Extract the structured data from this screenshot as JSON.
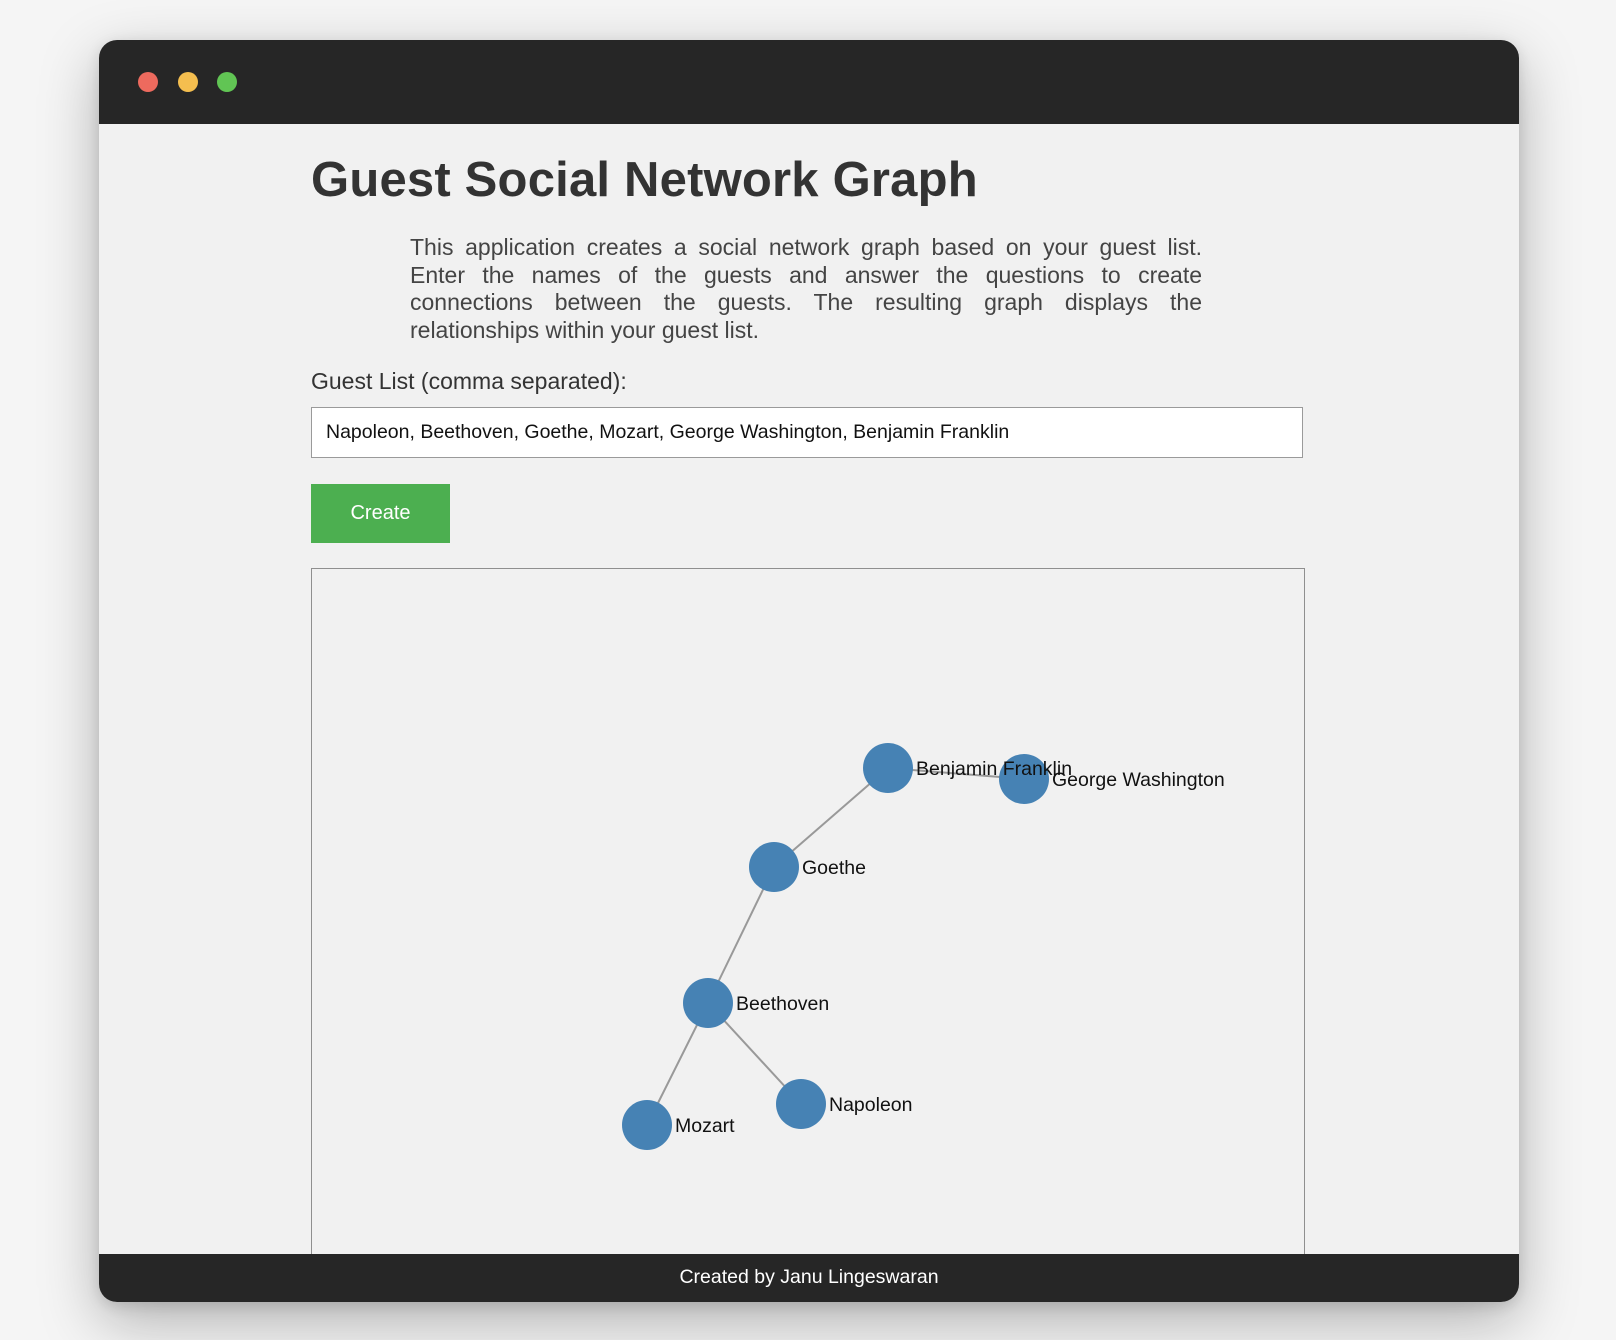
{
  "window": {
    "controls": [
      "close",
      "minimize",
      "maximize"
    ]
  },
  "page": {
    "title": "Guest Social Network Graph",
    "description": "This application creates a social network graph based on your guest list. Enter the names of the guests and answer the questions to create connections between the guests. The resulting graph displays the relationships within your guest list."
  },
  "form": {
    "guest_label": "Guest List (comma separated):",
    "guest_value": "Napoleon, Beethoven, Goethe, Mozart, George Washington, Benjamin Franklin",
    "create_label": "Create"
  },
  "graph": {
    "node_color": "#4682b4",
    "edge_color": "#999999",
    "nodes": [
      {
        "id": "Benjamin Franklin",
        "label": "Benjamin Franklin"
      },
      {
        "id": "George Washington",
        "label": "George Washington"
      },
      {
        "id": "Goethe",
        "label": "Goethe"
      },
      {
        "id": "Beethoven",
        "label": "Beethoven"
      },
      {
        "id": "Mozart",
        "label": "Mozart"
      },
      {
        "id": "Napoleon",
        "label": "Napoleon"
      }
    ],
    "edges": [
      [
        "Benjamin Franklin",
        "George Washington"
      ],
      [
        "Benjamin Franklin",
        "Goethe"
      ],
      [
        "Goethe",
        "Beethoven"
      ],
      [
        "Beethoven",
        "Mozart"
      ],
      [
        "Beethoven",
        "Napoleon"
      ]
    ]
  },
  "footer": {
    "text": "Created by Janu Lingeswaran"
  },
  "colors": {
    "titlebar": "#262626",
    "button": "#4caf50",
    "background": "#f1f1f1"
  }
}
